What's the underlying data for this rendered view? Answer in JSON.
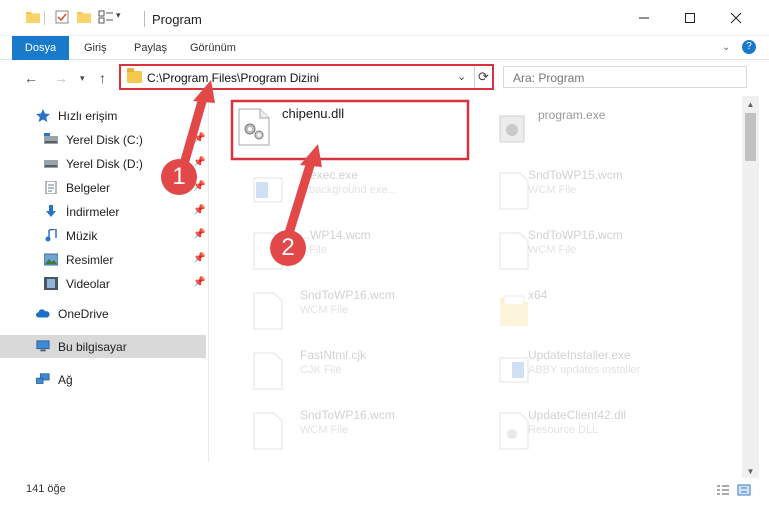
{
  "window": {
    "title": "Program"
  },
  "ribbon": {
    "tabs": [
      "Dosya",
      "Giriş",
      "Paylaş",
      "Görünüm"
    ]
  },
  "address": {
    "path": "C:\\Program Files\\Program Dizini"
  },
  "search": {
    "placeholder": "Ara: Program"
  },
  "sidebar": {
    "items": [
      {
        "label": "Hızlı erişim"
      },
      {
        "label": "Yerel Disk (C:)"
      },
      {
        "label": "Yerel Disk (D:)"
      },
      {
        "label": "Belgeler"
      },
      {
        "label": "İndirmeler"
      },
      {
        "label": "Müzik"
      },
      {
        "label": "Resimler"
      },
      {
        "label": "Videolar"
      },
      {
        "label": "OneDrive"
      },
      {
        "label": "Bu bilgisayar"
      },
      {
        "label": "Ağ"
      }
    ]
  },
  "files": [
    {
      "name": "chipenu.dll",
      "type": ""
    },
    {
      "name": "program.exe",
      "type": ""
    },
    {
      "name": "...exec.exe",
      "type": "...background exe..."
    },
    {
      "name": "SndToWP15.wcm",
      "type": "WCM File"
    },
    {
      "name": "...WP14.wcm",
      "type": "...File"
    },
    {
      "name": "SndToWP16.wcm",
      "type": "WCM File"
    },
    {
      "name": "SndToWP16.wcm",
      "type": "WCM File"
    },
    {
      "name": "x64",
      "type": ""
    },
    {
      "name": "FastNtml.cjk",
      "type": "CJK File"
    },
    {
      "name": "UpdateInstaller.exe",
      "type": "ABBY updates installer"
    },
    {
      "name": "SndToWP16.wcm",
      "type": "WCM File"
    },
    {
      "name": "UpdateClient42.dll",
      "type": "Resource DLL"
    }
  ],
  "status": {
    "count": "141 öğe"
  },
  "annotations": {
    "step1": "1",
    "step2": "2"
  },
  "colors": {
    "accent": "#1979ca",
    "highlight": "#d8333d",
    "arrow": "#e24848"
  }
}
